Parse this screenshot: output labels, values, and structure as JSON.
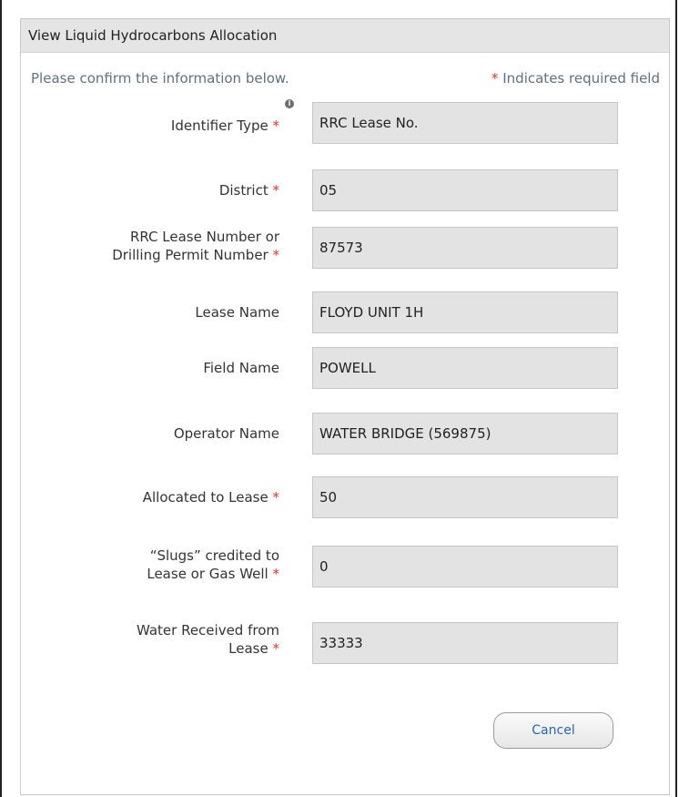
{
  "dialog": {
    "title": "View Liquid Hydrocarbons Allocation",
    "confirm_text": "Please confirm the information below.",
    "required_star": "*",
    "required_note": " Indicates required field"
  },
  "fields": {
    "identifier_type": {
      "label": "Identifier Type",
      "value": "RRC Lease No."
    },
    "district": {
      "label": "District",
      "value": "05"
    },
    "lease_number": {
      "label_line1": "RRC Lease Number or",
      "label_line2": "Drilling Permit Number",
      "value": "87573"
    },
    "lease_name": {
      "label": "Lease Name",
      "value": "FLOYD UNIT 1H"
    },
    "field_name": {
      "label": "Field Name",
      "value": "POWELL"
    },
    "operator_name": {
      "label": "Operator Name",
      "value": "WATER BRIDGE (569875)"
    },
    "allocated": {
      "label": "Allocated to Lease",
      "value": "50"
    },
    "slugs": {
      "label_line1": "“Slugs” credited to",
      "label_line2": "Lease or Gas Well",
      "value": "0"
    },
    "water": {
      "label_line1": "Water Received from",
      "label_line2": "Lease",
      "value": "33333"
    }
  },
  "buttons": {
    "cancel": "Cancel"
  },
  "icons": {
    "info": "info-icon"
  },
  "colors": {
    "required": "#e0312f",
    "cancel_text": "#2a64b2",
    "field_bg": "#e3e3e3"
  }
}
